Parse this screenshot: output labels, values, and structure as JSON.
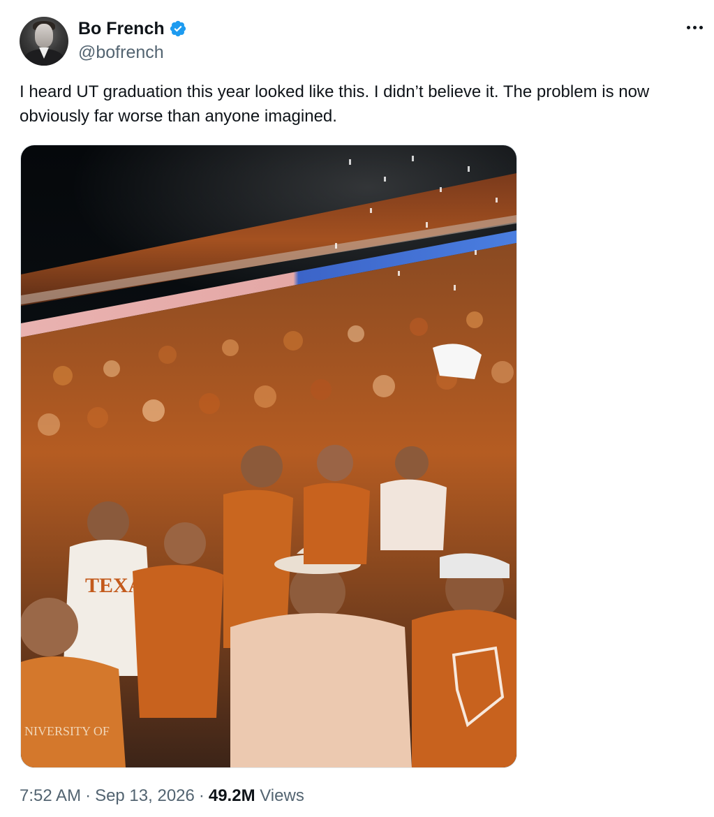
{
  "author": {
    "display_name": "Bo French",
    "handle": "@bofrench",
    "verified": true,
    "verified_color": "#1d9bf0"
  },
  "tweet": {
    "text": "I heard UT graduation this year looked like this. I didn’t believe it. The problem is now obviously far worse than anyone imagined."
  },
  "media": {
    "shirt_text_1": "TEXAS",
    "shirt_text_2": "NIVERSITY OF"
  },
  "meta": {
    "time": "7:52 AM",
    "date": "Sep 13, 2026",
    "views_count": "49.2M",
    "views_label": "Views"
  },
  "icons": {
    "more": "more-horizontal-icon",
    "verified": "verified-badge-icon"
  }
}
